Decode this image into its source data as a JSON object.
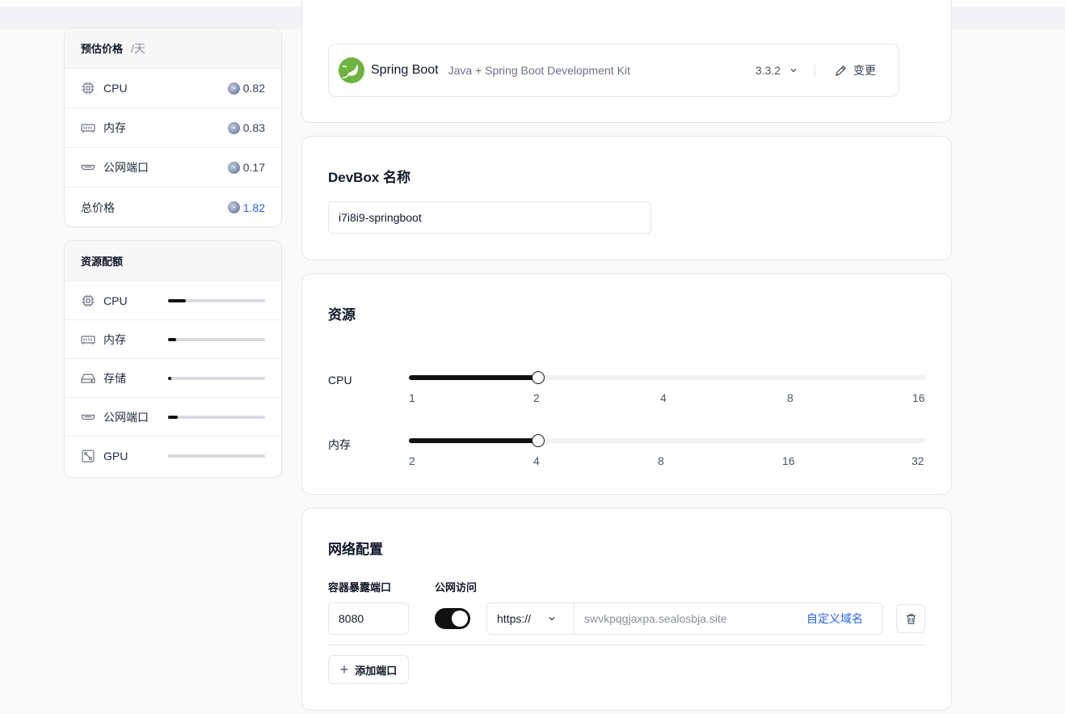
{
  "price_panel": {
    "title": "预估价格",
    "unit": "/天",
    "rows": [
      {
        "icon": "cpu-icon",
        "label": "CPU",
        "value": "0.82"
      },
      {
        "icon": "memory-icon",
        "label": "内存",
        "value": "0.83"
      },
      {
        "icon": "port-icon",
        "label": "公网端口",
        "value": "0.17"
      }
    ],
    "total_label": "总价格",
    "total_value": "1.82",
    "accent_color": "#2563eb"
  },
  "quota_panel": {
    "title": "资源配额",
    "rows": [
      {
        "icon": "cpu-icon",
        "label": "CPU",
        "usage": 0.18
      },
      {
        "icon": "memory-icon",
        "label": "内存",
        "usage": 0.08
      },
      {
        "icon": "storage-icon",
        "label": "存储",
        "usage": 0.03
      },
      {
        "icon": "port-icon",
        "label": "公网端口",
        "usage": 0.1
      },
      {
        "icon": "gpu-icon",
        "label": "GPU",
        "usage": 0
      }
    ]
  },
  "runtime": {
    "name": "Spring Boot",
    "description": "Java + Spring Boot Development Kit",
    "version": "3.3.2",
    "change_label": "变更",
    "brand_color": "#6db33f"
  },
  "devbox_name": {
    "title": "DevBox 名称",
    "value": "i7i8i9-springboot"
  },
  "resources": {
    "title": "资源",
    "cpu": {
      "label": "CPU",
      "ticks": [
        "1",
        "2",
        "4",
        "8",
        "16"
      ],
      "selected_index": 1
    },
    "memory": {
      "label": "内存",
      "ticks": [
        "2",
        "4",
        "8",
        "16",
        "32"
      ],
      "selected_index": 1
    }
  },
  "network": {
    "title": "网络配置",
    "port_label": "容器暴露端口",
    "public_label": "公网访问",
    "port_value": "8080",
    "public_enabled": true,
    "protocol": "https://",
    "domain": "swvkpqgjaxpa.sealosbja.site",
    "custom_domain_label": "自定义域名",
    "add_port_label": "添加端口"
  }
}
